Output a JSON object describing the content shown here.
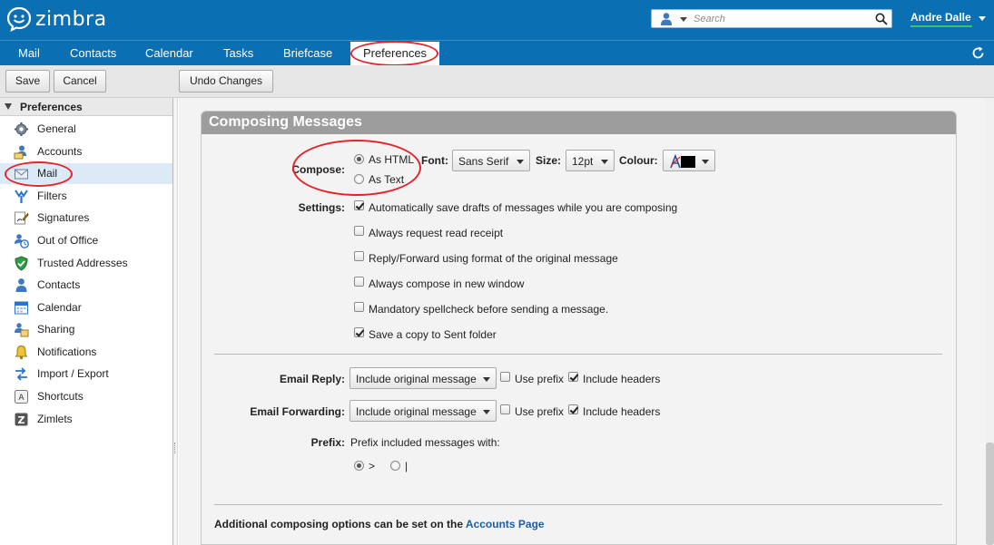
{
  "header": {
    "brand": "zimbra",
    "search_placeholder": "Search",
    "user_name": "Andre Dalle"
  },
  "app_tabs": [
    "Mail",
    "Contacts",
    "Calendar",
    "Tasks",
    "Briefcase",
    "Preferences"
  ],
  "toolbar": {
    "save": "Save",
    "cancel": "Cancel",
    "undo": "Undo Changes"
  },
  "sidebar": {
    "title": "Preferences",
    "items": [
      {
        "label": "General",
        "icon": "gear-icon"
      },
      {
        "label": "Accounts",
        "icon": "accounts-icon"
      },
      {
        "label": "Mail",
        "icon": "envelope-icon"
      },
      {
        "label": "Filters",
        "icon": "filter-icon"
      },
      {
        "label": "Signatures",
        "icon": "signature-icon"
      },
      {
        "label": "Out of Office",
        "icon": "out-of-office-icon"
      },
      {
        "label": "Trusted Addresses",
        "icon": "shield-check-icon"
      },
      {
        "label": "Contacts",
        "icon": "contact-icon"
      },
      {
        "label": "Calendar",
        "icon": "calendar-icon"
      },
      {
        "label": "Sharing",
        "icon": "sharing-icon"
      },
      {
        "label": "Notifications",
        "icon": "bell-icon"
      },
      {
        "label": "Import / Export",
        "icon": "import-export-icon"
      },
      {
        "label": "Shortcuts",
        "icon": "keyboard-shortcut-icon"
      },
      {
        "label": "Zimlets",
        "icon": "zimlet-icon"
      }
    ],
    "selected": "Mail"
  },
  "composing": {
    "title": "Composing Messages",
    "compose_label": "Compose:",
    "as_html": "As HTML",
    "as_text": "As Text",
    "compose_selected": "As HTML",
    "font_label": "Font:",
    "font_value": "Sans Serif",
    "size_label": "Size:",
    "size_value": "12pt",
    "colour_label": "Colour:",
    "colour_value": "#000000",
    "settings_label": "Settings:",
    "settings": [
      {
        "label": "Automatically save drafts of messages while you are composing",
        "checked": true
      },
      {
        "label": "Always request read receipt",
        "checked": false
      },
      {
        "label": "Reply/Forward using format of the original message",
        "checked": false
      },
      {
        "label": "Always compose in new window",
        "checked": false
      },
      {
        "label": "Mandatory spellcheck before sending a message.",
        "checked": false
      },
      {
        "label": "Save a copy to Sent folder",
        "checked": true
      }
    ],
    "email_reply_label": "Email Reply:",
    "email_reply_value": "Include original message",
    "email_reply_use_prefix": {
      "label": "Use prefix",
      "checked": false
    },
    "email_reply_include_headers": {
      "label": "Include headers",
      "checked": true
    },
    "email_forwarding_label": "Email Forwarding:",
    "email_forwarding_value": "Include original message",
    "email_forwarding_use_prefix": {
      "label": "Use prefix",
      "checked": false
    },
    "email_forwarding_include_headers": {
      "label": "Include headers",
      "checked": true
    },
    "prefix_label": "Prefix:",
    "prefix_text": "Prefix included messages with:",
    "prefix_options": [
      ">",
      "|"
    ],
    "prefix_selected": ">",
    "footer_text": "Additional composing options can be set on the ",
    "footer_link": "Accounts Page"
  },
  "annotation_color": "#e5242a"
}
